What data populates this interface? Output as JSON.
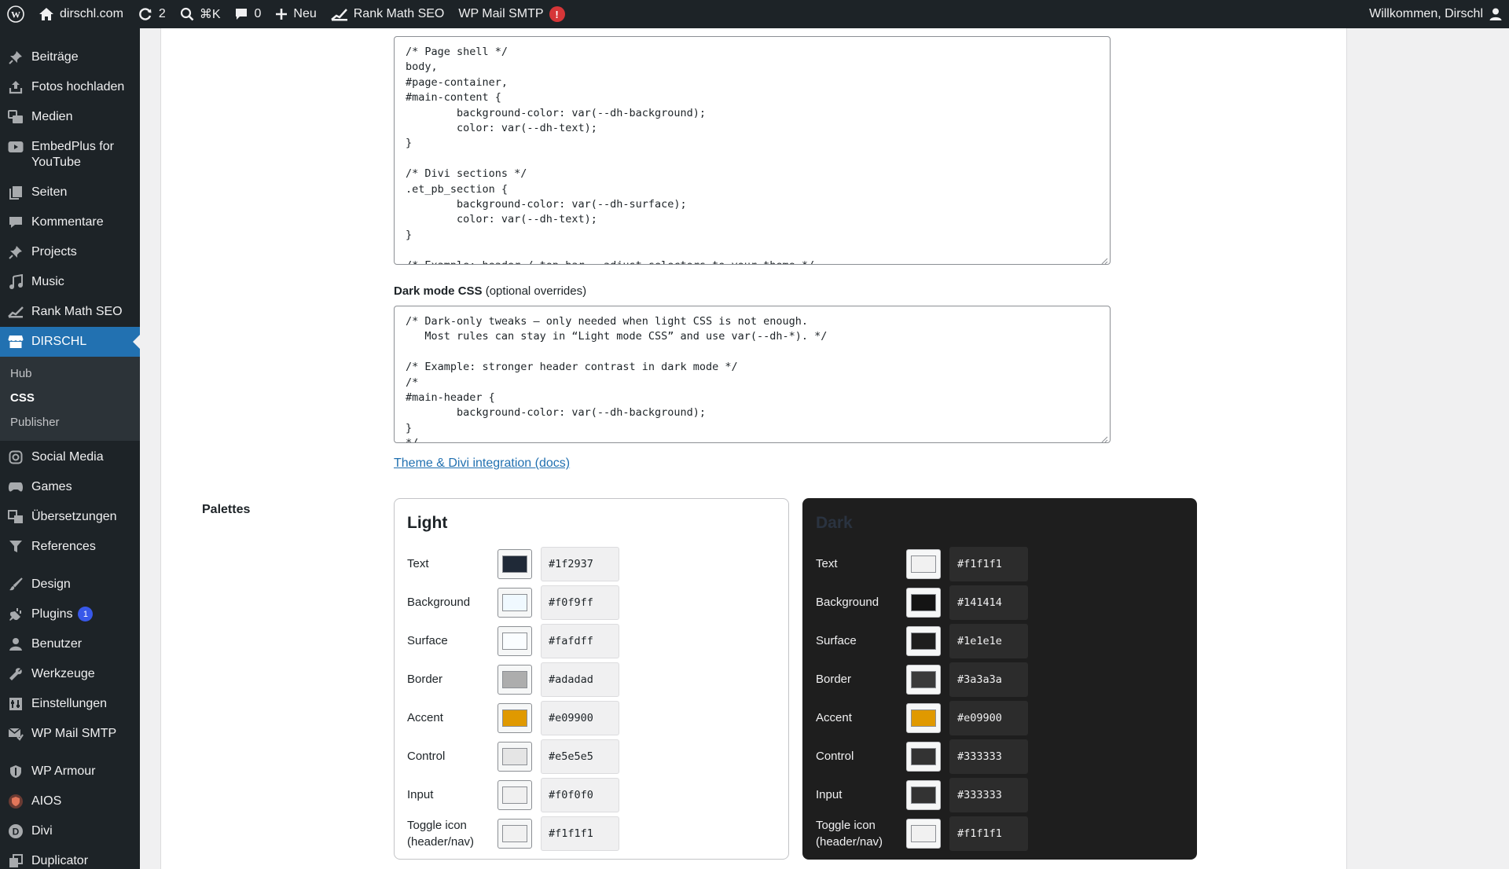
{
  "adminbar": {
    "site_name": "dirschl.com",
    "updates_count": "2",
    "search_shortcut": "⌘K",
    "comments_count": "0",
    "new_label": "Neu",
    "rankmath_label": "Rank Math SEO",
    "smtp_label": "WP Mail SMTP",
    "smtp_alert": "!",
    "greeting": "Willkommen, Dirschl"
  },
  "sidebar": {
    "items_top": [
      {
        "label": "Beiträge",
        "icon": "pin-icon"
      },
      {
        "label": "Fotos hochladen",
        "icon": "upload-icon"
      },
      {
        "label": "Medien",
        "icon": "media-icon"
      },
      {
        "label": "EmbedPlus for YouTube",
        "icon": "youtube-icon"
      },
      {
        "label": "Seiten",
        "icon": "pages-icon"
      },
      {
        "label": "Kommentare",
        "icon": "comment-icon"
      },
      {
        "label": "Projects",
        "icon": "pin-icon"
      },
      {
        "label": "Music",
        "icon": "music-icon"
      },
      {
        "label": "Rank Math SEO",
        "icon": "rankmath-icon"
      }
    ],
    "active": {
      "label": "DIRSCHL",
      "icon": "store-icon"
    },
    "submenu": [
      "Hub",
      "CSS",
      "Publisher"
    ],
    "items_mid": [
      {
        "label": "Social Media",
        "icon": "instagram-icon"
      },
      {
        "label": "Games",
        "icon": "gamepad-icon"
      },
      {
        "label": "Übersetzungen",
        "icon": "translate-icon"
      },
      {
        "label": "References",
        "icon": "filter-icon"
      }
    ],
    "items_bottom": [
      {
        "label": "Design",
        "icon": "brush-icon"
      },
      {
        "label": "Plugins",
        "icon": "plugin-icon",
        "badge": "1"
      },
      {
        "label": "Benutzer",
        "icon": "user-icon"
      },
      {
        "label": "Werkzeuge",
        "icon": "wrench-icon"
      },
      {
        "label": "Einstellungen",
        "icon": "settings-icon"
      },
      {
        "label": "WP Mail SMTP",
        "icon": "mail-icon"
      }
    ],
    "items_end": [
      {
        "label": "WP Armour",
        "icon": "shield-icon"
      },
      {
        "label": "AIOS",
        "icon": "aios-icon"
      },
      {
        "label": "Divi",
        "icon": "divi-icon"
      },
      {
        "label": "Duplicator",
        "icon": "duplicator-icon"
      }
    ]
  },
  "light_css": {
    "content": "/* Page shell */\nbody,\n#page-container,\n#main-content {\n        background-color: var(--dh-background);\n        color: var(--dh-text);\n}\n\n/* Divi sections */\n.et_pb_section {\n        background-color: var(--dh-surface);\n        color: var(--dh-text);\n}\n\n/* Example: header / top bar — adjust selectors to your theme */"
  },
  "dark_css": {
    "label": "Dark mode CSS",
    "hint": "(optional overrides)",
    "content": "/* Dark-only tweaks — only needed when light CSS is not enough.\n   Most rules can stay in “Light mode CSS” and use var(--dh-*). */\n\n/* Example: stronger header contrast in dark mode */\n/*\n#main-header {\n        background-color: var(--dh-background);\n}\n*/"
  },
  "docs_link": "Theme & Divi integration (docs)",
  "palettes_label": "Palettes",
  "palettes": {
    "light": {
      "title": "Light",
      "rows": [
        {
          "name": "Text",
          "hex": "#1f2937"
        },
        {
          "name": "Background",
          "hex": "#f0f9ff"
        },
        {
          "name": "Surface",
          "hex": "#fafdff"
        },
        {
          "name": "Border",
          "hex": "#adadad"
        },
        {
          "name": "Accent",
          "hex": "#e09900"
        },
        {
          "name": "Control",
          "hex": "#e5e5e5"
        },
        {
          "name": "Input",
          "hex": "#f0f0f0"
        },
        {
          "name": "Toggle icon (header/nav)",
          "hex": "#f1f1f1"
        }
      ]
    },
    "dark": {
      "title": "Dark",
      "rows": [
        {
          "name": "Text",
          "hex": "#f1f1f1"
        },
        {
          "name": "Background",
          "hex": "#141414"
        },
        {
          "name": "Surface",
          "hex": "#1e1e1e"
        },
        {
          "name": "Border",
          "hex": "#3a3a3a"
        },
        {
          "name": "Accent",
          "hex": "#e09900"
        },
        {
          "name": "Control",
          "hex": "#333333"
        },
        {
          "name": "Input",
          "hex": "#333333"
        },
        {
          "name": "Toggle icon (header/nav)",
          "hex": "#f1f1f1"
        }
      ]
    }
  },
  "colors": {
    "adminbar_bg": "#1d2327",
    "menu_active": "#2271b1",
    "badge_blue": "#3858e9",
    "alert_red": "#d63638"
  }
}
